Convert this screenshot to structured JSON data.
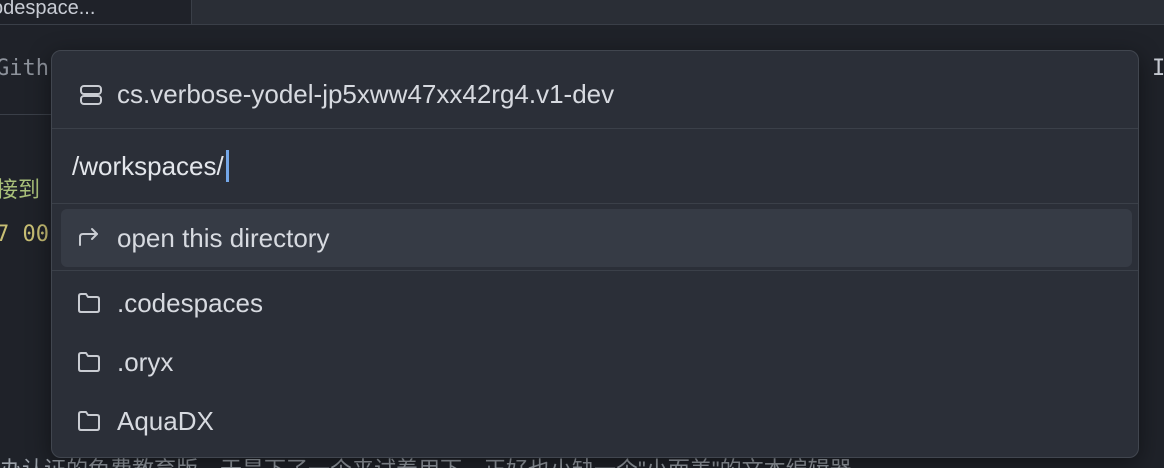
{
  "background": {
    "tab_label": "odespace...",
    "left_fragment_1": "Gith",
    "left_fragment_2": "接到",
    "left_fragment_3": "7 00",
    "right_fragment": "I",
    "bottom_fragment": "办认证的免费教育版，于是下了一个来试着用下，正好也小缺一个\"小而美\"的文本编辑器"
  },
  "palette": {
    "host": {
      "icon": "server-icon",
      "label": "cs.verbose-yodel-jp5xww47xx42rg4.v1-dev"
    },
    "path_input": {
      "value": "/workspaces/"
    },
    "items": [
      {
        "icon": "redirect-arrow-icon",
        "label": "open this directory",
        "selected": true
      },
      {
        "icon": "folder-icon",
        "label": ".codespaces",
        "selected": false
      },
      {
        "icon": "folder-icon",
        "label": ".oryx",
        "selected": false
      },
      {
        "icon": "folder-icon",
        "label": "AquaDX",
        "selected": false
      }
    ]
  },
  "colors": {
    "accent_caret": "#74a7e8",
    "palette_bg": "#2b2f38",
    "selected_row": "#363b45"
  }
}
